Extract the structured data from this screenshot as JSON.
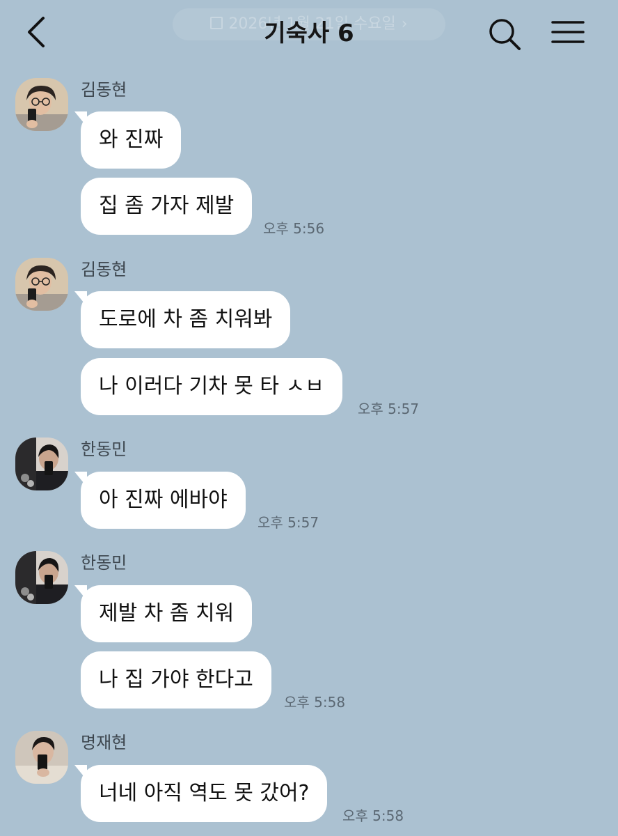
{
  "colors": {
    "background": "#abc1d1",
    "bubble": "#ffffff",
    "text": "#111111",
    "meta_text": "#5b6873"
  },
  "header": {
    "title": "기숙사 6",
    "date_pill": "2026년 1월 21일 수요일",
    "back_icon": "chevron-left-icon",
    "search_icon": "search-icon",
    "menu_icon": "hamburger-menu-icon"
  },
  "messages": [
    {
      "sender": "김동현",
      "avatar": "avatar-kim-donghyun",
      "bubbles": [
        "와 진짜",
        "집 좀 가자 제발"
      ],
      "time": "오후 5:56"
    },
    {
      "sender": "김동현",
      "avatar": "avatar-kim-donghyun",
      "bubbles": [
        "도로에 차 좀 치워봐",
        "나 이러다 기차 못 타 ㅅㅂ"
      ],
      "time": "오후 5:57"
    },
    {
      "sender": "한동민",
      "avatar": "avatar-han-dongmin",
      "bubbles": [
        "아 진짜 에바야"
      ],
      "time": "오후 5:57"
    },
    {
      "sender": "한동민",
      "avatar": "avatar-han-dongmin",
      "bubbles": [
        "제발 차 좀 치워",
        "나 집 가야 한다고"
      ],
      "time": "오후 5:58"
    },
    {
      "sender": "명재현",
      "avatar": "avatar-myung-jaehyun",
      "bubbles": [
        "너네 아직 역도 못 갔어?"
      ],
      "time": "오후 5:58"
    }
  ]
}
